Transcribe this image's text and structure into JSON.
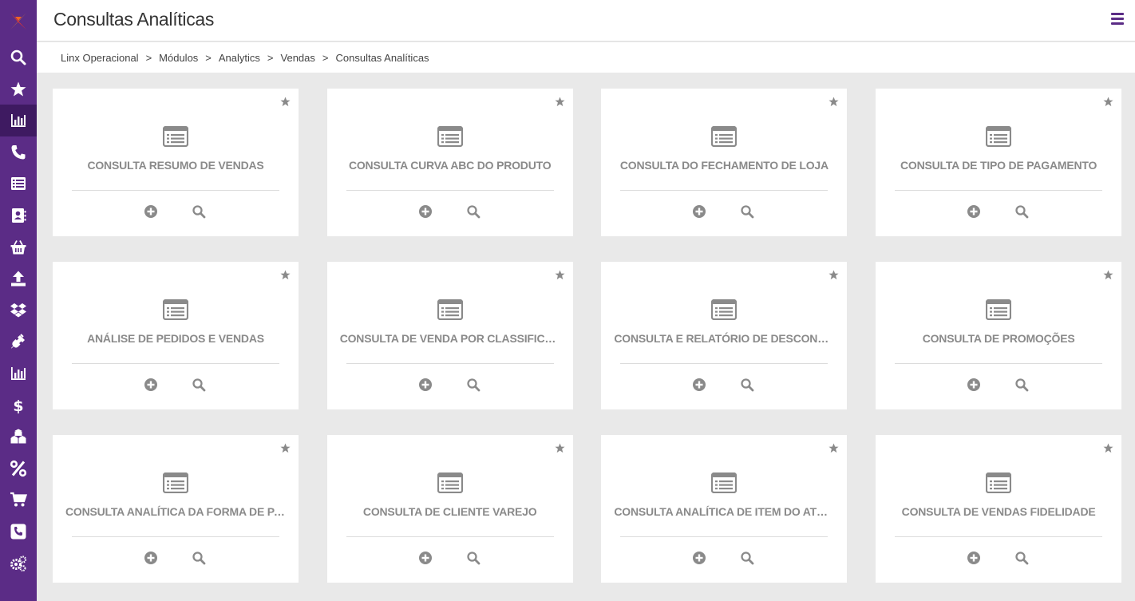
{
  "header": {
    "title": "Consultas Analíticas",
    "menu_icon": "hamburger-icon"
  },
  "breadcrumb": [
    "Linx Operacional",
    "Módulos",
    "Analytics",
    "Vendas",
    "Consultas Analíticas"
  ],
  "breadcrumb_separator": ">",
  "colors": {
    "sidebar": "#5b2c86",
    "sidebar_active": "#3e1a61",
    "card_text": "#8a8a8a",
    "icon_gray": "#8a8a8a",
    "background": "#e9e9e9"
  },
  "sidebar": {
    "items": [
      {
        "icon": "search-icon"
      },
      {
        "icon": "star-icon"
      },
      {
        "icon": "bar-chart-icon",
        "active": true
      },
      {
        "icon": "phone-icon"
      },
      {
        "icon": "list-icon"
      },
      {
        "icon": "contacts-icon"
      },
      {
        "icon": "basket-icon"
      },
      {
        "icon": "upload-icon"
      },
      {
        "icon": "dropbox-icon"
      },
      {
        "icon": "plug-icon"
      },
      {
        "icon": "bar-chart-icon"
      },
      {
        "icon": "dollar-icon"
      },
      {
        "icon": "cubes-icon"
      },
      {
        "icon": "percent-icon"
      },
      {
        "icon": "cart-icon"
      },
      {
        "icon": "phone-square-icon"
      },
      {
        "icon": "gears-icon"
      }
    ]
  },
  "cards": [
    {
      "title": "CONSULTA RESUMO DE VENDAS"
    },
    {
      "title": "CONSULTA CURVA ABC DO PRODUTO"
    },
    {
      "title": "CONSULTA DO FECHAMENTO DE LOJA"
    },
    {
      "title": "CONSULTA DE TIPO DE PAGAMENTO"
    },
    {
      "title": "ANÁLISE DE PEDIDOS E VENDAS"
    },
    {
      "title": "CONSULTA DE VENDA POR CLASSIFICAÇÃO ..."
    },
    {
      "title": "CONSULTA E RELATÓRIO DE DESCONTOS"
    },
    {
      "title": "CONSULTA DE PROMOÇÕES"
    },
    {
      "title": "CONSULTA ANALÍTICA DA FORMA DE PAGAM..."
    },
    {
      "title": "CONSULTA DE CLIENTE VAREJO"
    },
    {
      "title": "CONSULTA ANALÍTICA DE ITEM DO ATENDIM..."
    },
    {
      "title": "CONSULTA DE VENDAS FIDELIDADE"
    }
  ]
}
